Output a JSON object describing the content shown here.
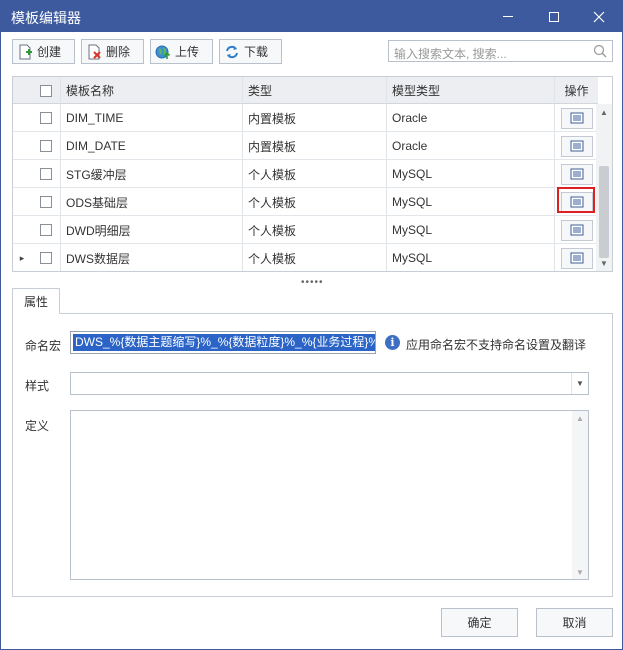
{
  "window": {
    "title": "模板编辑器",
    "controls": [
      "minimize-icon",
      "maximize-icon",
      "close-icon"
    ]
  },
  "toolbar": {
    "create_label": "创建",
    "delete_label": "删除",
    "upload_label": "上传",
    "download_label": "下载"
  },
  "search": {
    "placeholder": "输入搜索文本, 搜索..."
  },
  "grid": {
    "columns": [
      "模板名称",
      "类型",
      "模型类型",
      "操作"
    ],
    "rows": [
      {
        "name": "DIM_TIME",
        "type": "内置模板",
        "model_type": "Oracle"
      },
      {
        "name": "DIM_DATE",
        "type": "内置模板",
        "model_type": "Oracle"
      },
      {
        "name": "STG缓冲层",
        "type": "个人模板",
        "model_type": "MySQL"
      },
      {
        "name": "ODS基础层",
        "type": "个人模板",
        "model_type": "MySQL"
      },
      {
        "name": "DWD明细层",
        "type": "个人模板",
        "model_type": "MySQL"
      },
      {
        "name": "DWS数据层",
        "type": "个人模板",
        "model_type": "MySQL"
      }
    ],
    "current_row_indicator": "▸",
    "highlighted_row": "ODS基础层"
  },
  "properties": {
    "tab_label": "属性",
    "naming_macro_label": "命名宏",
    "naming_macro_value": "DWS_%{数据主题缩写}%_%{数据粒度}%_%{业务过程}%",
    "info_icon": "i",
    "info_text": "应用命名宏不支持命名设置及翻译",
    "style_label": "样式",
    "style_value": "",
    "definition_label": "定义",
    "definition_value": ""
  },
  "footer": {
    "ok_label": "确定",
    "cancel_label": "取消"
  },
  "colors": {
    "titlebar": "#3d5a9f",
    "selection": "#2b64c6",
    "highlight": "#e02020"
  }
}
